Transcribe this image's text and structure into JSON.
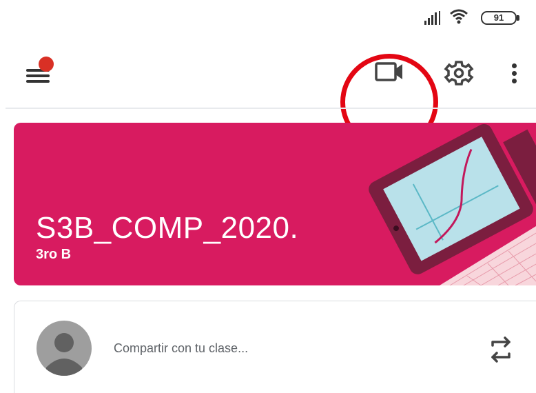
{
  "status_bar": {
    "battery_level": "91",
    "icons": [
      "signal-icon",
      "wifi-icon",
      "battery-icon"
    ]
  },
  "app_bar": {
    "icons": [
      "menu-icon",
      "video-camera-icon",
      "settings-gear-icon",
      "more-vert-icon"
    ],
    "notification_dot_color": "#d93025",
    "highlight_ring_color": "#e30613"
  },
  "class_card": {
    "title": "S3B_COMP_2020.",
    "section": "3ro B",
    "banner_color": "#d81b60"
  },
  "stream": {
    "share_placeholder": "Compartir con tu clase...",
    "icons": [
      "user-avatar-icon",
      "repost-icon"
    ]
  }
}
